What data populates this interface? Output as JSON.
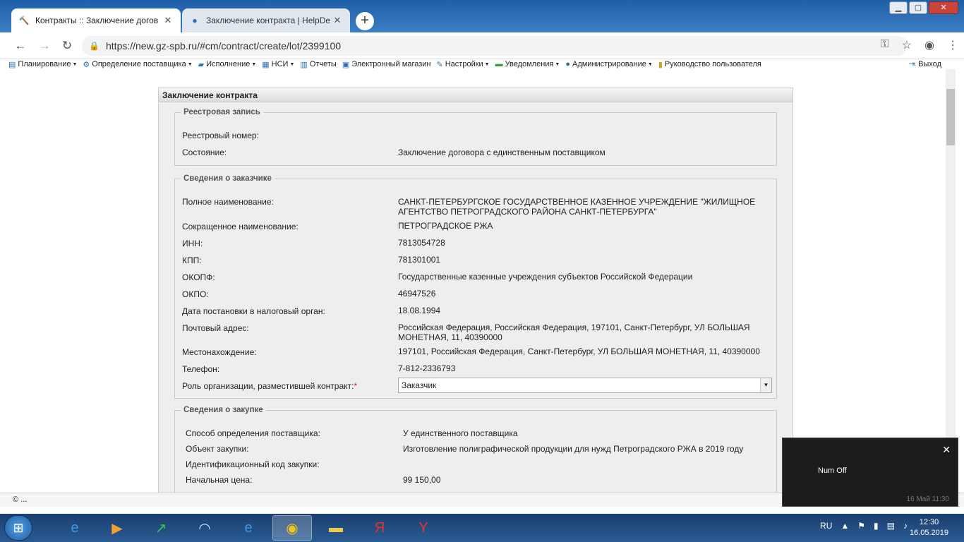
{
  "window": {
    "tabs": [
      {
        "label": "Контракты :: Заключение догов",
        "icon": "gavel-icon"
      },
      {
        "label": "Заключение контракта | HelpDe",
        "icon": "info-icon"
      }
    ],
    "new_tab": "+"
  },
  "address": {
    "url": "https://new.gz-spb.ru/#cm/contract/create/lot/2399100"
  },
  "menu": {
    "items": [
      {
        "label": "Планирование"
      },
      {
        "label": "Определение поставщика"
      },
      {
        "label": "Исполнение"
      },
      {
        "label": "НСИ"
      },
      {
        "label": "Отчеты"
      },
      {
        "label": "Электронный магазин"
      },
      {
        "label": "Настройки"
      },
      {
        "label": "Уведомления"
      },
      {
        "label": "Администрирование"
      },
      {
        "label": "Руководство пользователя"
      }
    ],
    "logout": "Выход"
  },
  "panel": {
    "title": "Заключение контракта",
    "registry": {
      "legend": "Реестровая запись",
      "reg_number_label": "Реестровый номер:",
      "state_label": "Состояние:",
      "state_value": "Заключение договора с единственным поставщиком"
    },
    "customer": {
      "legend": "Сведения о заказчике",
      "full_name_label": "Полное наименование:",
      "full_name_value": "САНКТ-ПЕТЕРБУРГСКОЕ ГОСУДАРСТВЕННОЕ КАЗЕННОЕ УЧРЕЖДЕНИЕ \"ЖИЛИЩНОЕ АГЕНТСТВО ПЕТРОГРАДСКОГО РАЙОНА САНКТ-ПЕТЕРБУРГА\"",
      "short_name_label": "Сокращенное наименование:",
      "short_name_value": "ПЕТРОГРАДСКОЕ РЖА",
      "inn_label": "ИНН:",
      "inn_value": "7813054728",
      "kpp_label": "КПП:",
      "kpp_value": "781301001",
      "okopf_label": "ОКОПФ:",
      "okopf_value": "Государственные казенные учреждения субъектов Российской Федерации",
      "okpo_label": "ОКПО:",
      "okpo_value": "46947526",
      "tax_date_label": "Дата постановки в налоговый орган:",
      "tax_date_value": "18.08.1994",
      "postal_label": "Почтовый адрес:",
      "postal_value": "Российская Федерация, Российская Федерация, 197101, Санкт-Петербург, УЛ БОЛЬШАЯ МОНЕТНАЯ, 11, 40390000",
      "location_label": "Местонахождение:",
      "location_value": "197101, Российская Федерация, Санкт-Петербург, УЛ БОЛЬШАЯ МОНЕТНАЯ, 11, 40390000",
      "phone_label": "Телефон:",
      "phone_value": "7-812-2336793",
      "role_label": "Роль организации, разместившей контракт:",
      "role_required": "*",
      "role_value": "Заказчик"
    },
    "purchase": {
      "legend": "Сведения о закупке",
      "method_label": "Способ определения поставщика:",
      "method_value": "У единственного поставщика",
      "object_label": "Объект закупки:",
      "object_value": "Изготовление полиграфической продукции для нужд Петроградского РЖА в 2019 году",
      "ikz_label": "Идентификационный код закупки:",
      "price_label": "Начальная цена:",
      "price_value": "99 150,00"
    }
  },
  "status": {
    "text": "© ..."
  },
  "toast": {
    "text": "Num Off",
    "time": "16 Май 11:30"
  },
  "taskbar": {
    "lang": "RU",
    "time": "12:30",
    "date": "16.05.2019"
  }
}
